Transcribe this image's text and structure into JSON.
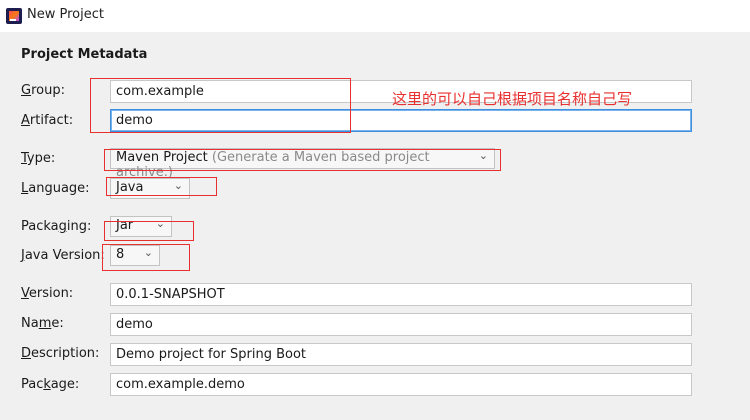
{
  "window": {
    "title": "New Project",
    "icon": "intellij-idea-icon"
  },
  "section_title": "Project Metadata",
  "annotation": "这里的可以自己根据项目名称自己写",
  "fields": {
    "group": {
      "label_pre": "",
      "mnemonic": "G",
      "label_post": "roup:",
      "value": "com.example"
    },
    "artifact": {
      "label_pre": "",
      "mnemonic": "A",
      "label_post": "rtifact:",
      "value": "demo"
    },
    "version": {
      "label_pre": "",
      "mnemonic": "V",
      "label_post": "ersion:",
      "value": "0.0.1-SNAPSHOT"
    },
    "name": {
      "label_pre": "Na",
      "mnemonic": "m",
      "label_post": "e:",
      "value": "demo"
    },
    "description": {
      "label_pre": "",
      "mnemonic": "D",
      "label_post": "escription:",
      "value": "Demo project for Spring Boot"
    },
    "package": {
      "label_pre": "Pac",
      "mnemonic": "k",
      "label_post": "age:",
      "value": "com.example.demo"
    }
  },
  "selects": {
    "type": {
      "label_pre": "",
      "mnemonic": "T",
      "label_post": "ype:",
      "value": "Maven Project",
      "hint": "(Generate a Maven based project archive.)"
    },
    "language": {
      "label_pre": "",
      "mnemonic": "L",
      "label_post": "anguage:",
      "value": "Java"
    },
    "packaging": {
      "label_pre": "Packa",
      "mnemonic": "g",
      "label_post": "ing:",
      "value": "Jar"
    },
    "java_version": {
      "label_pre": "",
      "mnemonic": "J",
      "label_post": "ava Version:",
      "value": "8"
    }
  },
  "colors": {
    "annotation_red": "#e8312f",
    "focus_blue": "#3f8fe0"
  }
}
